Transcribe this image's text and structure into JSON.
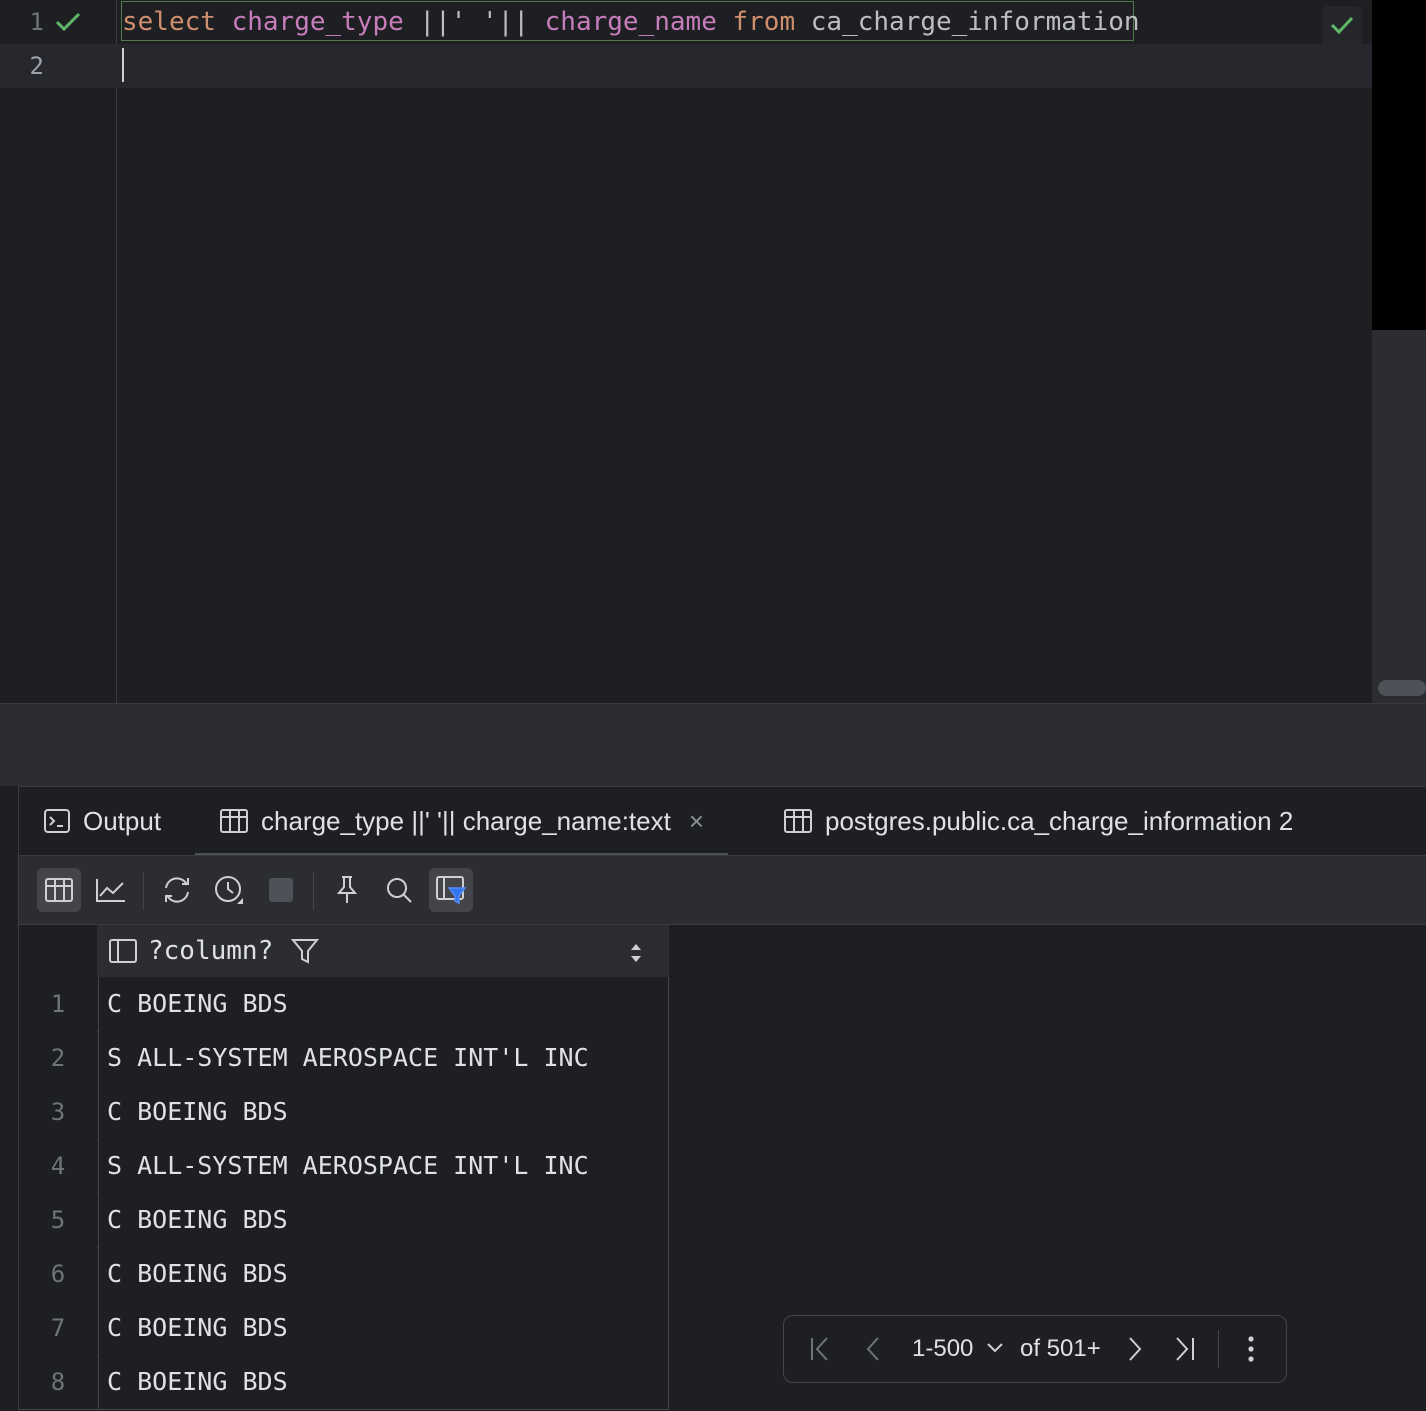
{
  "editor": {
    "lines": [
      {
        "number": "1",
        "tokens": [
          "select",
          "charge_type",
          "||' '||",
          "charge_name",
          "from",
          "ca_charge_information"
        ]
      },
      {
        "number": "2"
      }
    ]
  },
  "results": {
    "tabs": [
      {
        "label": "Output",
        "icon": "console-icon"
      },
      {
        "label": "charge_type ||' '|| charge_name:text",
        "icon": "table-icon",
        "close": "×",
        "active": true
      },
      {
        "label": "postgres.public.ca_charge_information 2",
        "icon": "table-icon"
      }
    ],
    "toolbar": [
      "table-view-icon",
      "chart-view-icon",
      "refresh-icon",
      "history-icon",
      "stop-icon",
      "pin-icon",
      "search-icon",
      "filter-view-icon"
    ],
    "grid": {
      "column_header": "?column?",
      "rows": [
        {
          "n": "1",
          "value": "C BOEING BDS"
        },
        {
          "n": "2",
          "value": "S ALL-SYSTEM AEROSPACE INT'L INC"
        },
        {
          "n": "3",
          "value": "C BOEING BDS"
        },
        {
          "n": "4",
          "value": "S ALL-SYSTEM AEROSPACE INT'L INC"
        },
        {
          "n": "5",
          "value": "C BOEING BDS"
        },
        {
          "n": "6",
          "value": "C BOEING BDS"
        },
        {
          "n": "7",
          "value": "C BOEING BDS"
        },
        {
          "n": "8",
          "value": "C BOEING BDS"
        }
      ]
    },
    "pager": {
      "range": "1-500",
      "total": "of 501+"
    }
  },
  "colors": {
    "background": "#1e1f22",
    "keyword": "#cf8e6d",
    "identifier": "#c77dbb",
    "string": "#6aab73",
    "check": "#5fb865"
  }
}
